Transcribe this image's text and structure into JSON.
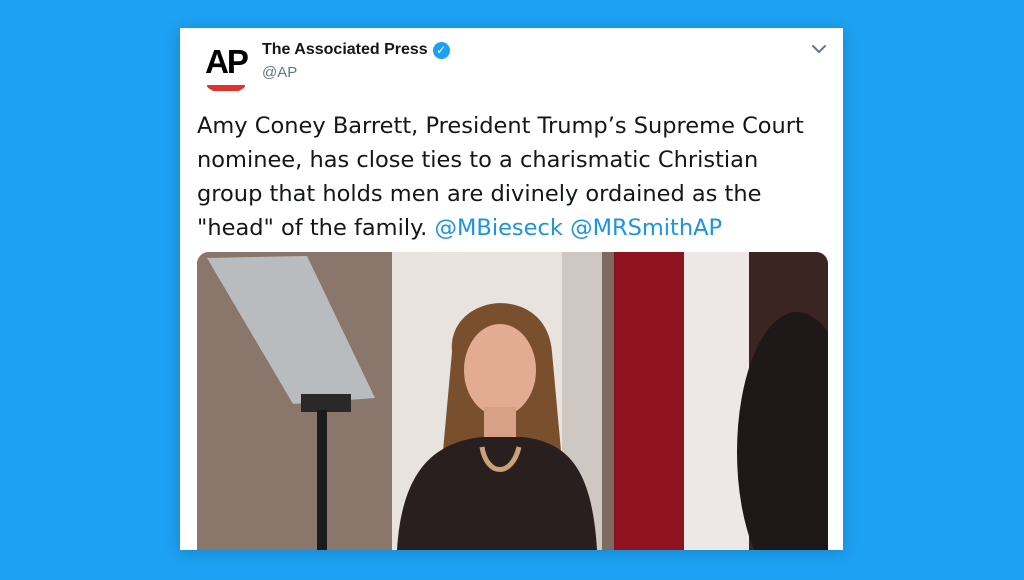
{
  "tweet": {
    "author_name": "The Associated Press",
    "author_handle": "@AP",
    "avatar_logo_text": "AP",
    "verified_icon": "verified-badge-icon",
    "menu_icon": "chevron-down-icon",
    "text_parts": {
      "body": "Amy Coney Barrett, President Trump’s Supreme Court nominee, has close ties to a charismatic Christian group that holds men are divinely ordained as the \"head\" of the family. ",
      "mention_1": "@MBieseck",
      "space": " ",
      "mention_2": "@MRSmithAP"
    },
    "media_icon": "photo-image"
  },
  "colors": {
    "background": "#1da1f2",
    "card": "#ffffff",
    "link": "#1b95e0",
    "text": "#14171a",
    "muted": "#657786",
    "ap_red": "#e0332f"
  }
}
